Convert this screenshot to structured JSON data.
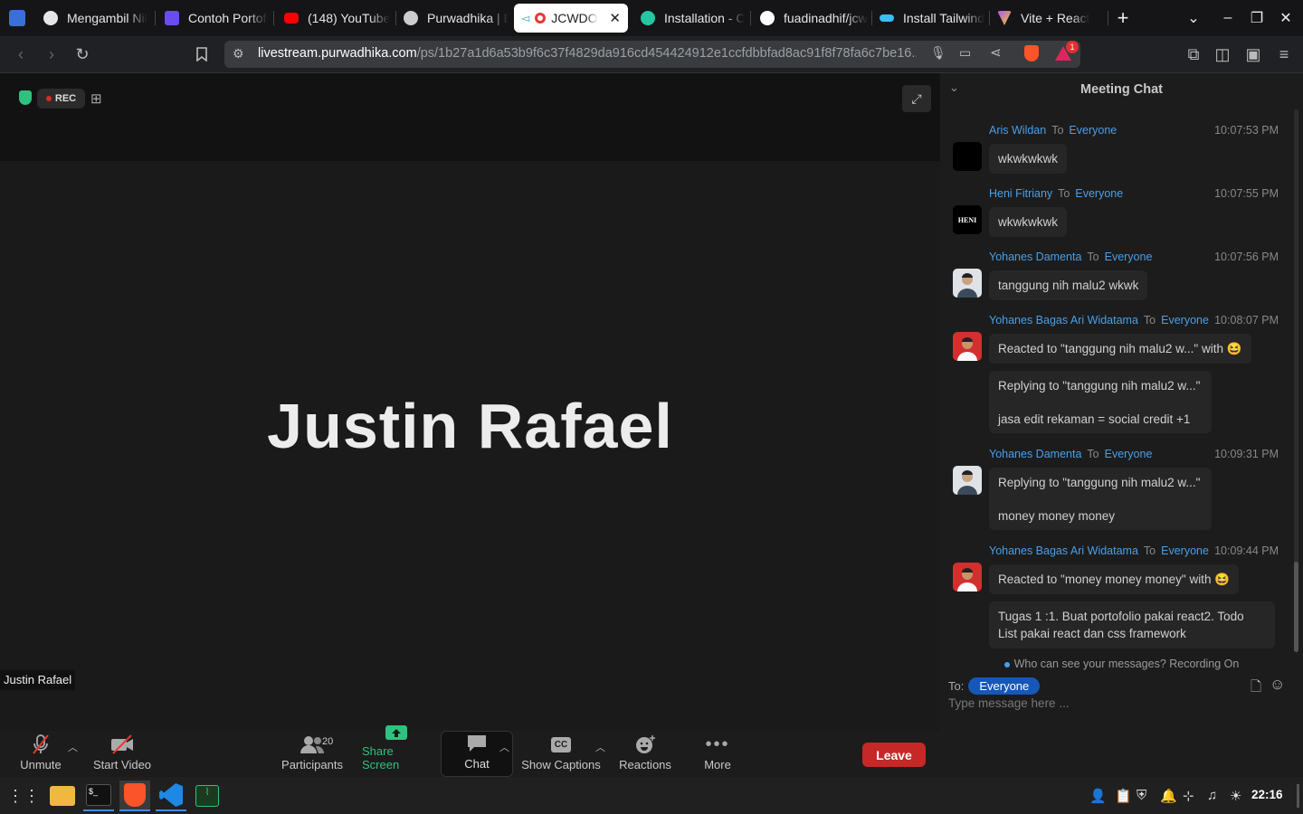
{
  "browser": {
    "tabs": [
      {
        "title": "Mengambil Nil",
        "favicon_color": "#4a7df0"
      },
      {
        "title": "Contoh Portofo",
        "favicon_color": "#6b4cf0"
      },
      {
        "title": "(148) YouTube",
        "favicon_color": "#ff0000"
      },
      {
        "title": "Purwadhika | E",
        "favicon_color": "#cccccc"
      },
      {
        "title": "JCWDO",
        "favicon_color": "#e53935",
        "active": true
      },
      {
        "title": "Installation - C",
        "favicon_color": "#26c6a2"
      },
      {
        "title": "fuadinadhif/jcw",
        "favicon_color": "#ffffff"
      },
      {
        "title": "Install Tailwind",
        "favicon_color": "#38bdf8"
      },
      {
        "title": "Vite + React",
        "favicon_color": "#a855f7"
      }
    ],
    "url_domain": "livestream.purwadhika.com",
    "url_path": "/ps/1b27a1d6a53b9f6c37f4829da916cd454424912e1ccfdbbfad8ac91f8f78fa6c7be16...",
    "brave_badge": "1"
  },
  "meeting": {
    "rec_label": "REC",
    "speaker_big": "Justin Rafael",
    "speaker_label": "Justin Rafael"
  },
  "toolbar": {
    "unmute": "Unmute",
    "start_video": "Start Video",
    "participants": "Participants",
    "participants_count": "20",
    "share_screen": "Share Screen",
    "chat": "Chat",
    "captions": "Show Captions",
    "captions_icon": "CC",
    "reactions": "Reactions",
    "more": "More",
    "leave": "Leave"
  },
  "chat": {
    "title": "Meeting Chat",
    "to_word": "To",
    "messages": [
      {
        "sender": "Aris Wildan",
        "to": "Everyone",
        "time": "10:07:53 PM",
        "lines": [
          "wkwkwkwk"
        ]
      },
      {
        "sender": "Heni Fitriany",
        "to": "Everyone",
        "time": "10:07:55 PM",
        "lines": [
          "wkwkwkwk"
        ],
        "avatar_text": "HENI"
      },
      {
        "sender": "Yohanes Damenta",
        "to": "Everyone",
        "time": "10:07:56 PM",
        "lines": [
          "tanggung nih malu2 wkwk"
        ]
      },
      {
        "sender": "Yohanes Bagas Ari Widatama",
        "to": "Everyone",
        "time": "10:08:07 PM",
        "lines": [
          "Reacted to \"tanggung nih malu2 w...\" with 😆",
          "Replying to \"tanggung nih malu2 w...\"",
          "jasa edit rekaman = social credit +1"
        ]
      },
      {
        "sender": "Yohanes Damenta",
        "to": "Everyone",
        "time": "10:09:31 PM",
        "lines": [
          "Replying to \"tanggung nih malu2 w...\"",
          "money money money"
        ]
      },
      {
        "sender": "Yohanes Bagas Ari Widatama",
        "to": "Everyone",
        "time": "10:09:44 PM",
        "lines": [
          "Reacted to \"money money money\" with 😆",
          "Tugas 1 :1. Buat portofolio pakai react2. Todo",
          "List pakai react dan css framework"
        ]
      }
    ],
    "info": "Who can see your messages? Recording On",
    "to_label": "To:",
    "recipient": "Everyone",
    "placeholder": "Type message here ..."
  },
  "taskbar": {
    "clock": "22:16"
  }
}
